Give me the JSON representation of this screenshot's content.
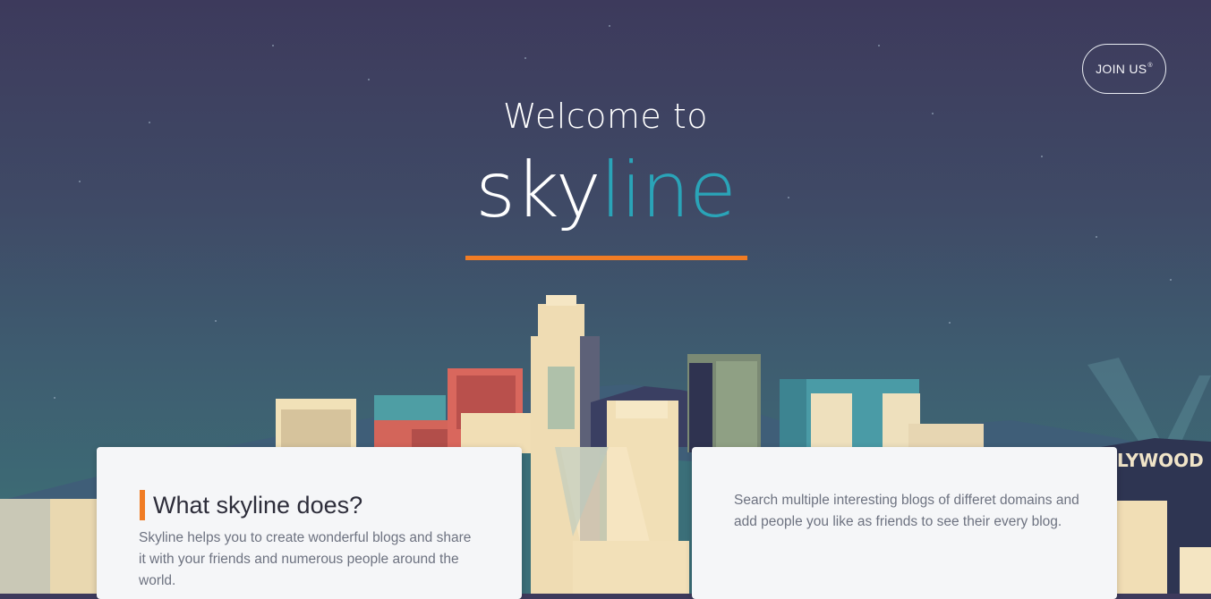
{
  "header": {
    "join_label": "JOIN US",
    "join_mark": "®"
  },
  "hero": {
    "welcome": "Welcome to",
    "brand_part1": "sky",
    "brand_part2": "line",
    "colors": {
      "accent": "#2aa4b8",
      "underline": "#f07c24"
    }
  },
  "sign_text": "LYWOOD",
  "cards": [
    {
      "title": "What skyline does?",
      "text": "Skyline helps you to create wonderful blogs and share it with your friends and numerous people around the world."
    },
    {
      "text": "Search multiple interesting blogs of differet domains and add people you like as friends to see their every blog."
    }
  ]
}
